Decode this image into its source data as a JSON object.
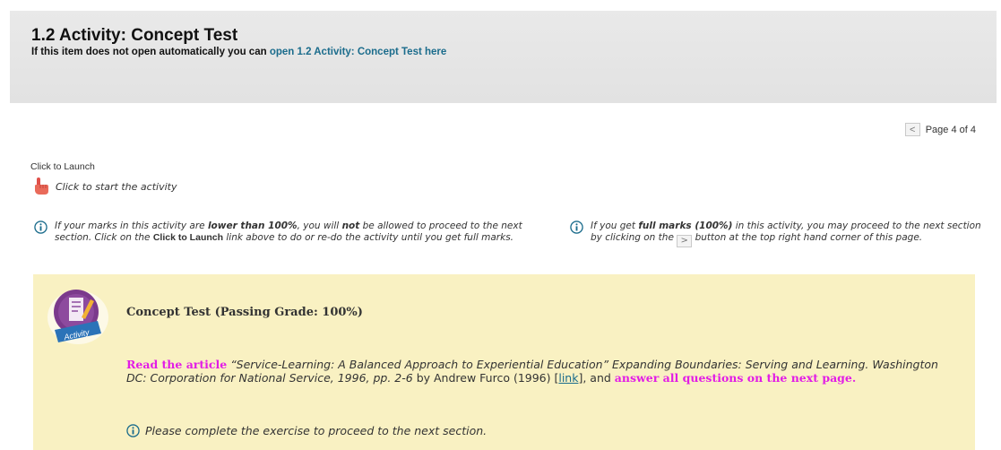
{
  "header": {
    "title": "1.2 Activity: Concept Test",
    "subtitle_prefix": "If this item does not open automatically you can",
    "subtitle_link": "open 1.2 Activity: Concept Test here"
  },
  "pager": {
    "label": "Page 4 of 4",
    "prev_glyph": "<"
  },
  "launch": {
    "label": "Click to Launch",
    "link_text": "Click to start the activity"
  },
  "note_left": {
    "t1": "If your marks in this activity are ",
    "b1": "lower than 100%",
    "t2": ", you will ",
    "b2": "not",
    "t3": " be allowed to proceed to the next section. Click on the ",
    "b3": "Click to Launch",
    "t4": " link above to do or re-do the activity until you get full marks."
  },
  "note_right": {
    "t1": "If you get ",
    "b1": "full marks (100%)",
    "t2": " in this activity, you may proceed to the next section by clicking on the ",
    "next_glyph": ">",
    "t3": " button at the top right hand corner of this page."
  },
  "panel": {
    "badge_text": "Activity",
    "title": "Concept Test (Passing Grade: 100%)",
    "read": "Read the article",
    "quote": " “Service-Learning: A Balanced Approach to Experiential Education” Expanding Boundaries: Serving and Learning. Washington DC: Corporation for National Service, 1996, pp. 2-6",
    "author": " by Andrew Furco (1996) [",
    "link": "link",
    "after_link": "], and ",
    "answer": "answer all questions on the next page.",
    "complete": "Please complete the exercise to proceed to the next section."
  },
  "colors": {
    "panel_bg": "#f9f1c2",
    "highlight": "#e21ce6",
    "link": "#1b6c8c",
    "info_icon": "#1b6c8c"
  }
}
